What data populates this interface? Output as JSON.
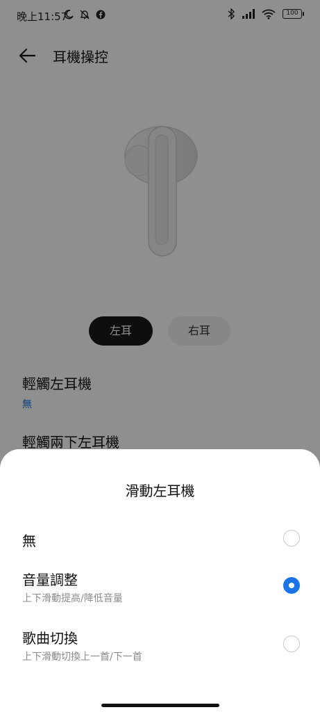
{
  "status_bar": {
    "time": "晚上11:57",
    "battery": "100",
    "icons_left": [
      "moon-icon",
      "alarm-off-icon",
      "facebook-icon"
    ],
    "icons_right": [
      "bluetooth-icon",
      "signal-icon",
      "wifi-icon",
      "battery-icon"
    ]
  },
  "header": {
    "title": "耳機操控",
    "back_icon": "arrow-left-icon"
  },
  "ear_tabs": {
    "left": "左耳",
    "right": "右耳",
    "selected": "left"
  },
  "settings": [
    {
      "label": "輕觸左耳機",
      "value": "無"
    },
    {
      "label": "輕觸兩下左耳機"
    }
  ],
  "sheet": {
    "title": "滑動左耳機",
    "options": [
      {
        "label": "無",
        "subtitle": "",
        "selected": false
      },
      {
        "label": "音量調整",
        "subtitle": "上下滑動提高/降低音量",
        "selected": true
      },
      {
        "label": "歌曲切換",
        "subtitle": "上下滑動切換上一首/下一首",
        "selected": false
      }
    ]
  },
  "colors": {
    "accent": "#1a73e8",
    "scrim": "rgba(0,0,0,0.44)",
    "selected_tab_bg": "#1a1a1a",
    "unselected_tab_bg": "#f1f1f1"
  }
}
